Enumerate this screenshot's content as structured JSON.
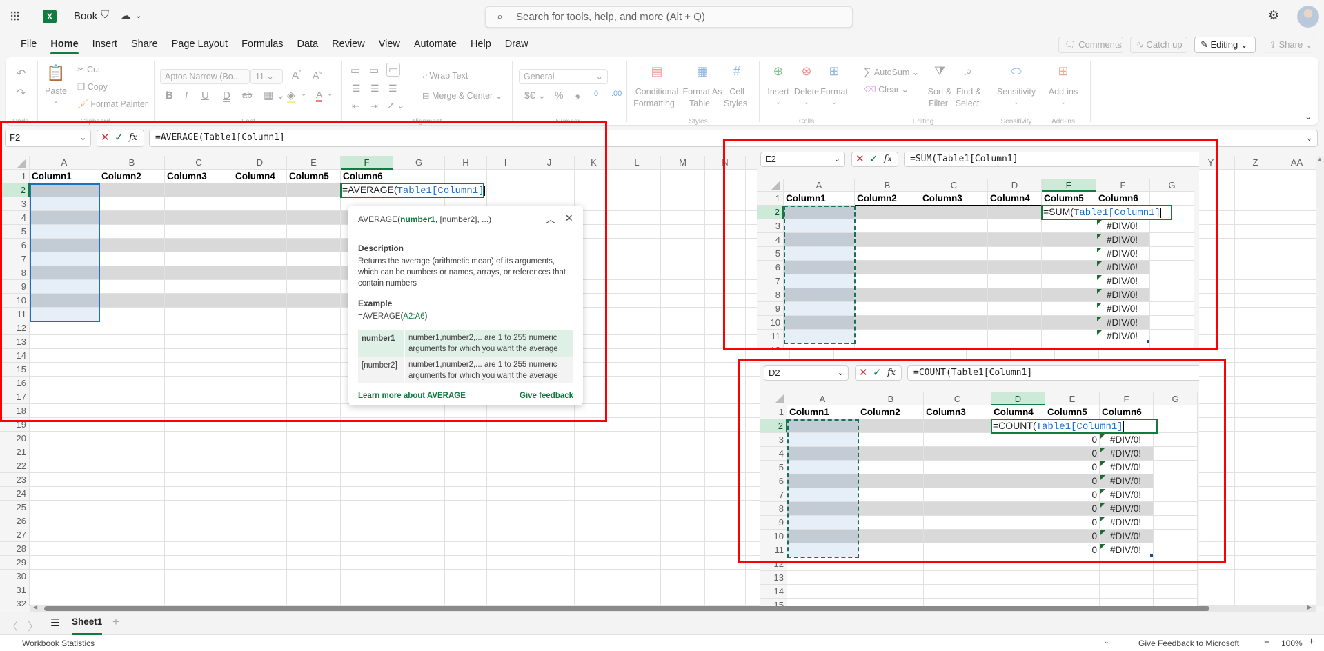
{
  "app": {
    "title": "Book",
    "search_placeholder": "Search for tools, help, and more (Alt + Q)",
    "logo_letter": "X"
  },
  "menu_tabs": [
    "File",
    "Home",
    "Insert",
    "Share",
    "Page Layout",
    "Formulas",
    "Data",
    "Review",
    "View",
    "Automate",
    "Help",
    "Draw"
  ],
  "active_tab": "Home",
  "header_buttons": {
    "comments": "Comments",
    "catch_up": "Catch up",
    "editing": "Editing",
    "share": "Share"
  },
  "ribbon": {
    "undo_group": "Undo",
    "clipboard": {
      "paste": "Paste",
      "cut": "Cut",
      "copy": "Copy",
      "format_painter": "Format Painter",
      "group": "Clipboard"
    },
    "font": {
      "font_name": "Aptos Narrow (Bo...",
      "font_size": "11",
      "group": "Font"
    },
    "alignment": {
      "wrap_text": "Wrap Text",
      "merge_center": "Merge & Center",
      "group": "Alignment"
    },
    "number": {
      "format": "General",
      "group": "Number"
    },
    "styles": {
      "conditional_1": "Conditional",
      "conditional_2": "Formatting",
      "format_table_1": "Format As",
      "format_table_2": "Table",
      "cell_styles_1": "Cell",
      "cell_styles_2": "Styles",
      "group": "Styles"
    },
    "cells": {
      "insert": "Insert",
      "delete": "Delete",
      "format": "Format",
      "group": "Cells"
    },
    "editing": {
      "autosum": "AutoSum",
      "clear": "Clear",
      "sort_1": "Sort &",
      "sort_2": "Filter",
      "find_1": "Find &",
      "find_2": "Select",
      "group": "Editing"
    },
    "sensitivity": {
      "label": "Sensitivity",
      "group": "Sensitivity"
    },
    "addins": {
      "label": "Add-ins",
      "group": "Add-ins"
    }
  },
  "formula_bar": {
    "name_box": "F2",
    "formula": "=AVERAGE(Table1[Column1]"
  },
  "main_sheet": {
    "columns": [
      "A",
      "B",
      "C",
      "D",
      "E",
      "F",
      "G",
      "H",
      "I",
      "J",
      "K",
      "L",
      "M",
      "N",
      "O",
      "P",
      "Q",
      "R",
      "S",
      "T",
      "U",
      "V",
      "W",
      "X",
      "Y",
      "Z",
      "AA"
    ],
    "row_count": 32,
    "table_headers": [
      "Column1",
      "Column2",
      "Column3",
      "Column4",
      "Column5",
      "Column6"
    ],
    "active_column": "F",
    "active_row": 2,
    "edit_fn": "=AVERAGE(",
    "edit_ref": "Table1[Column1]"
  },
  "tooltip": {
    "sig_fn": "AVERAGE(",
    "sig_arg1": "number1",
    "sig_rest": ", [number2], ...)",
    "description_title": "Description",
    "description": "Returns the average (arithmetic mean) of its arguments, which can be numbers or names, arrays, or references that contain numbers",
    "example_title": "Example",
    "example_fn": "=AVERAGE(",
    "example_ref": "A2:A6",
    "example_close": ")",
    "args": [
      {
        "name": "number1",
        "desc": "number1,number2,... are 1 to 255 numeric arguments for which you want the average"
      },
      {
        "name": "[number2]",
        "desc": "number1,number2,... are 1 to 255 numeric arguments for which you want the average"
      }
    ],
    "learn_more": "Learn more about AVERAGE",
    "feedback": "Give feedback"
  },
  "panel_sum": {
    "name_box": "E2",
    "formula": "=SUM(Table1[Column1]",
    "edit_fn": "=SUM(",
    "edit_ref": "Table1[Column1]",
    "columns": [
      "A",
      "B",
      "C",
      "D",
      "E",
      "F",
      "G"
    ],
    "row_count": 12,
    "active_column": "E",
    "table_headers": [
      "Column1",
      "Column2",
      "Column3",
      "Column4",
      "Column5",
      "Column6"
    ],
    "col_e_values": [
      "",
      "",
      "",
      "",
      "",
      "",
      "",
      "",
      ""
    ],
    "col_f_values": [
      "#DIV/0!",
      "#DIV/0!",
      "#DIV/0!",
      "#DIV/0!",
      "#DIV/0!",
      "#DIV/0!",
      "#DIV/0!",
      "#DIV/0!",
      "#DIV/0!"
    ]
  },
  "panel_count": {
    "name_box": "D2",
    "formula": "=COUNT(Table1[Column1]",
    "edit_fn": "=COUNT(",
    "edit_ref": "Table1[Column1]",
    "columns": [
      "A",
      "B",
      "C",
      "D",
      "E",
      "F",
      "G"
    ],
    "row_count": 15,
    "active_column": "D",
    "table_headers": [
      "Column1",
      "Column2",
      "Column3",
      "Column4",
      "Column5",
      "Column6"
    ],
    "col_e_values": [
      "0",
      "0",
      "0",
      "0",
      "0",
      "0",
      "0",
      "0",
      "0"
    ],
    "col_f_values": [
      "#DIV/0!",
      "#DIV/0!",
      "#DIV/0!",
      "#DIV/0!",
      "#DIV/0!",
      "#DIV/0!",
      "#DIV/0!",
      "#DIV/0!",
      "#DIV/0!"
    ]
  },
  "sheet_tabs": [
    "Sheet1"
  ],
  "status": {
    "left": "Workbook Statistics",
    "feedback": "Give Feedback to Microsoft",
    "zoom": "100%"
  },
  "colors": {
    "accent": "#107c41",
    "highlight_box": "#ff0000",
    "reference_blue": "#1f6fc5",
    "band_gray": "#d9d9d9",
    "selected_col_light": "#e6eef8",
    "selected_col_dark": "#c3ccd5"
  }
}
